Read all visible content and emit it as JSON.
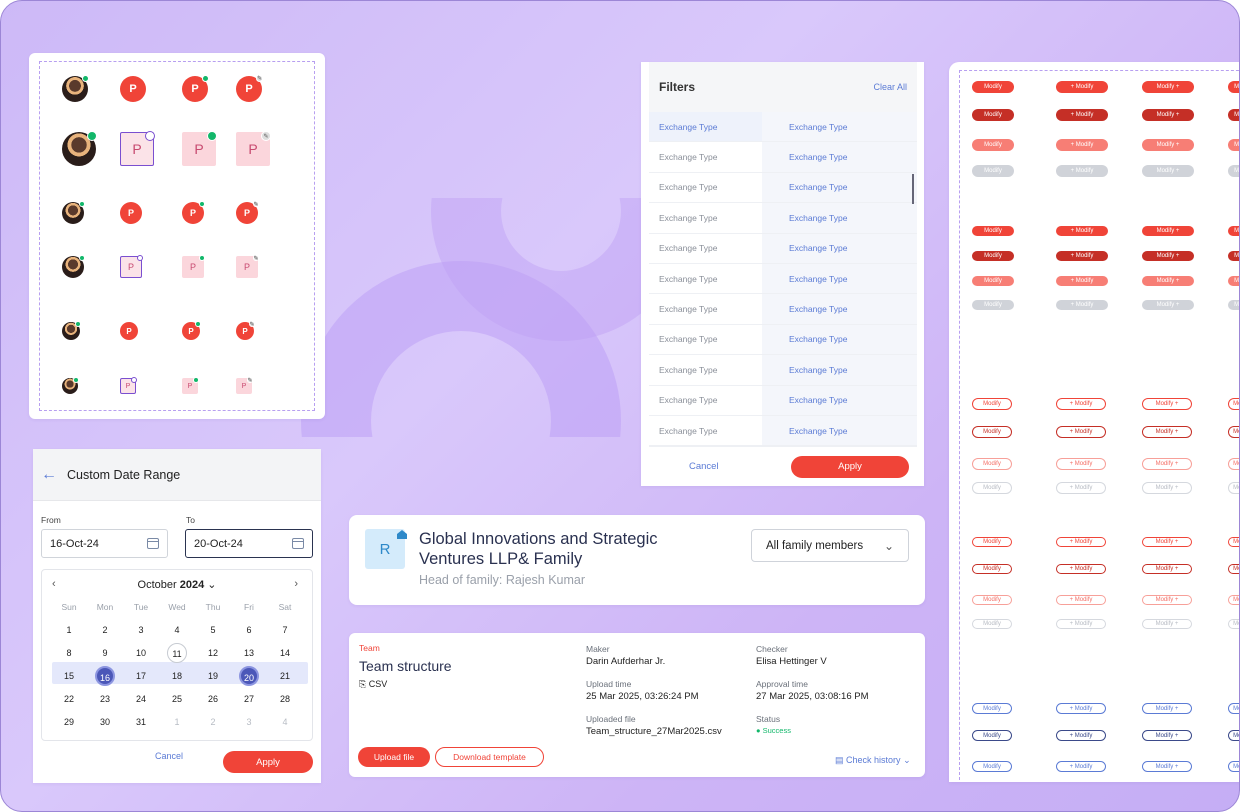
{
  "avatars": {
    "letter": "P",
    "edit_glyph": "✎",
    "check_glyph": "✓"
  },
  "filters": {
    "title": "Filters",
    "clear_all": "Clear All",
    "rows": [
      {
        "c1": "Exchange Type",
        "c2": "Exchange Type"
      },
      {
        "c1": "Exchange Type",
        "c2": "Exchange Type"
      },
      {
        "c1": "Exchange Type",
        "c2": "Exchange Type"
      },
      {
        "c1": "Exchange Type",
        "c2": "Exchange Type"
      },
      {
        "c1": "Exchange Type",
        "c2": "Exchange Type"
      },
      {
        "c1": "Exchange Type",
        "c2": "Exchange Type"
      },
      {
        "c1": "Exchange Type",
        "c2": "Exchange Type"
      },
      {
        "c1": "Exchange Type",
        "c2": "Exchange Type"
      },
      {
        "c1": "Exchange Type",
        "c2": "Exchange Type"
      },
      {
        "c1": "Exchange Type",
        "c2": "Exchange Type"
      },
      {
        "c1": "Exchange Type",
        "c2": "Exchange Type"
      }
    ],
    "cancel": "Cancel",
    "apply": "Apply"
  },
  "buttons": {
    "label": "Modify",
    "plus_label": "+ Modify",
    "label_plus": "Modify +",
    "disabled_plus": "+ Modify",
    "disabled_label_plus": "Modify +"
  },
  "date_range": {
    "title": "Custom Date Range",
    "from_label": "From",
    "to_label": "To",
    "from_value": "16-Oct-24",
    "to_value": "20-Oct-24",
    "month": "October",
    "year": "2024",
    "weekdays": [
      "Sun",
      "Mon",
      "Tue",
      "Wed",
      "Thu",
      "Fri",
      "Sat"
    ],
    "weeks": [
      [
        "1",
        "2",
        "3",
        "4",
        "5",
        "6",
        "7"
      ],
      [
        "8",
        "9",
        "10",
        "11",
        "12",
        "13",
        "14"
      ],
      [
        "15",
        "16",
        "17",
        "18",
        "19",
        "20",
        "21"
      ],
      [
        "22",
        "23",
        "24",
        "25",
        "26",
        "27",
        "28"
      ],
      [
        "29",
        "30",
        "31",
        "1",
        "2",
        "3",
        "4"
      ]
    ],
    "cancel": "Cancel",
    "apply": "Apply"
  },
  "family": {
    "avatar_letter": "R",
    "name": "Global Innovations and Strategic Ventures LLP& Family",
    "head": "Head of family: Rajesh Kumar",
    "selector": "All family members"
  },
  "team": {
    "category": "Team",
    "title": "Team structure",
    "format": "CSV",
    "maker_label": "Maker",
    "maker": "Darin Aufderhar Jr.",
    "checker_label": "Checker",
    "checker": "Elisa Hettinger V",
    "upload_time_label": "Upload time",
    "upload_time": "25 Mar 2025, 03:26:24 PM",
    "approval_time_label": "Approval time",
    "approval_time": "27 Mar 2025, 03:08:16  PM",
    "uploaded_file_label": "Uploaded file",
    "uploaded_file": "Team_structure_27Mar2025.csv",
    "status_label": "Status",
    "status": "Success",
    "upload_button": "Upload file",
    "download_button": "Download template",
    "history": "Check history"
  },
  "colors": {
    "accent": "#f04438",
    "link": "#5b7bd5",
    "background": "#d4c2f8",
    "success": "#12b76a"
  }
}
